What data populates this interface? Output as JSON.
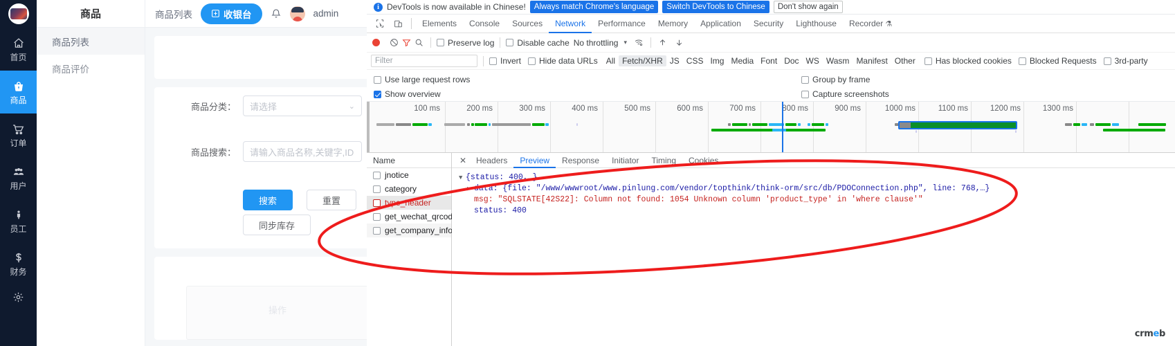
{
  "app": {
    "rail": [
      {
        "label": "首页",
        "icon": "home-icon",
        "active": false
      },
      {
        "label": "商品",
        "icon": "basket-icon",
        "active": true
      },
      {
        "label": "订单",
        "icon": "cart-icon",
        "active": false
      },
      {
        "label": "用户",
        "icon": "users-icon",
        "active": false
      },
      {
        "label": "员工",
        "icon": "staff-icon",
        "active": false
      },
      {
        "label": "财务",
        "icon": "dollar-icon",
        "active": false
      },
      {
        "label": "",
        "icon": "gear-icon",
        "active": false
      }
    ],
    "submenu": {
      "title": "商品",
      "items": [
        {
          "label": "商品列表",
          "active": true
        },
        {
          "label": "商品评价",
          "active": false
        }
      ]
    },
    "topbar": {
      "tab_label": "商品列表",
      "cashier_button": "收银台",
      "cashier_icon": "cashier-icon",
      "bell_icon": "bell-icon",
      "avatar_icon": "avatar",
      "username": "admin"
    },
    "form": {
      "category_label": "商品分类：",
      "category_value": "请选择",
      "search_label": "商品搜索：",
      "search_placeholder": "请输入商品名称,关键字,ID",
      "search_button": "搜索",
      "reset_button": "重置",
      "sync_button": "同步库存"
    },
    "table": {
      "ghost_header": "操作"
    },
    "colors": {
      "accent": "#2196f3",
      "rail_bg": "#0f1a2e"
    }
  },
  "devtools": {
    "notice": {
      "icon": "info-icon",
      "text": "DevTools is now available in Chinese!",
      "primary_1": "Always match Chrome's language",
      "primary_2": "Switch DevTools to Chinese",
      "dismiss": "Don't show again"
    },
    "tools": {
      "inspect_icon": "inspect-element-icon",
      "device_icon": "device-toolbar-icon"
    },
    "tabs": [
      {
        "label": "Elements",
        "active": false
      },
      {
        "label": "Console",
        "active": false
      },
      {
        "label": "Sources",
        "active": false
      },
      {
        "label": "Network",
        "active": true
      },
      {
        "label": "Performance",
        "active": false
      },
      {
        "label": "Memory",
        "active": false
      },
      {
        "label": "Application",
        "active": false
      },
      {
        "label": "Security",
        "active": false
      },
      {
        "label": "Lighthouse",
        "active": false
      },
      {
        "label": "Recorder",
        "active": false
      }
    ],
    "recorder_flask": "⚗",
    "toolbar": {
      "record_icon": "record-icon",
      "clear_icon": "clear-icon",
      "filter_icon": "filter-icon",
      "search_icon": "search-icon",
      "preserve_log": {
        "label": "Preserve log",
        "checked": false
      },
      "disable_cache": {
        "label": "Disable cache",
        "checked": false
      },
      "throttling": "No throttling",
      "caret": "▾",
      "wifi_icon": "network-conditions-icon",
      "import_icon": "import-har-icon",
      "export_icon": "export-har-icon"
    },
    "filterbar": {
      "filter_placeholder": "Filter",
      "invert": {
        "label": "Invert",
        "checked": false
      },
      "hide_data_urls": {
        "label": "Hide data URLs",
        "checked": false
      },
      "types": [
        {
          "label": "All",
          "selected": false
        },
        {
          "label": "Fetch/XHR",
          "selected": true
        },
        {
          "label": "JS",
          "selected": false
        },
        {
          "label": "CSS",
          "selected": false
        },
        {
          "label": "Img",
          "selected": false
        },
        {
          "label": "Media",
          "selected": false
        },
        {
          "label": "Font",
          "selected": false
        },
        {
          "label": "Doc",
          "selected": false
        },
        {
          "label": "WS",
          "selected": false
        },
        {
          "label": "Wasm",
          "selected": false
        },
        {
          "label": "Manifest",
          "selected": false
        },
        {
          "label": "Other",
          "selected": false
        }
      ],
      "has_blocked_cookies": {
        "label": "Has blocked cookies",
        "checked": false
      },
      "blocked_requests": {
        "label": "Blocked Requests",
        "checked": false
      },
      "third_party": {
        "label": "3rd-party",
        "checked": false
      }
    },
    "settings": {
      "use_large_request_rows": {
        "label": "Use large request rows",
        "checked": false
      },
      "show_overview": {
        "label": "Show overview",
        "checked": true
      },
      "group_by_frame": {
        "label": "Group by frame",
        "checked": false
      },
      "capture_screenshots": {
        "label": "Capture screenshots",
        "checked": false
      }
    },
    "overview": {
      "ticks": [
        "100 ms",
        "200 ms",
        "300 ms",
        "400 ms",
        "500 ms",
        "600 ms",
        "700 ms",
        "800 ms",
        "900 ms",
        "1000 ms",
        "1100 ms",
        "1200 ms",
        "1300 ms"
      ]
    },
    "requests": {
      "column_header": "Name",
      "rows": [
        {
          "name": "jnotice",
          "selected": false
        },
        {
          "name": "category",
          "selected": false
        },
        {
          "name": "type_header",
          "selected": true
        },
        {
          "name": "get_wechat_qrcode",
          "selected": false
        },
        {
          "name": "get_company_info",
          "selected": false
        }
      ]
    },
    "detail": {
      "close_icon": "close-icon",
      "tabs": [
        {
          "label": "Headers",
          "active": false
        },
        {
          "label": "Preview",
          "active": true
        },
        {
          "label": "Response",
          "active": false
        },
        {
          "label": "Initiator",
          "active": false
        },
        {
          "label": "Timing",
          "active": false
        },
        {
          "label": "Cookies",
          "active": false
        }
      ],
      "preview": {
        "root": "{status: 400,…}",
        "data_key": "data:",
        "data_value": "{file: \"/www/wwwroot/www.pinlung.com/vendor/topthink/think-orm/src/db/PDOConnection.php\", line: 768,…}",
        "msg_key": "msg:",
        "msg_value": "\"SQLSTATE[42S22]: Column not found: 1054 Unknown column 'product_type' in 'where clause'\"",
        "status_key": "status:",
        "status_value": "400"
      }
    },
    "watermark": "crmeb"
  },
  "annotation": {
    "shape": "red-ellipse-highlight",
    "color": "#ee1c1c"
  }
}
